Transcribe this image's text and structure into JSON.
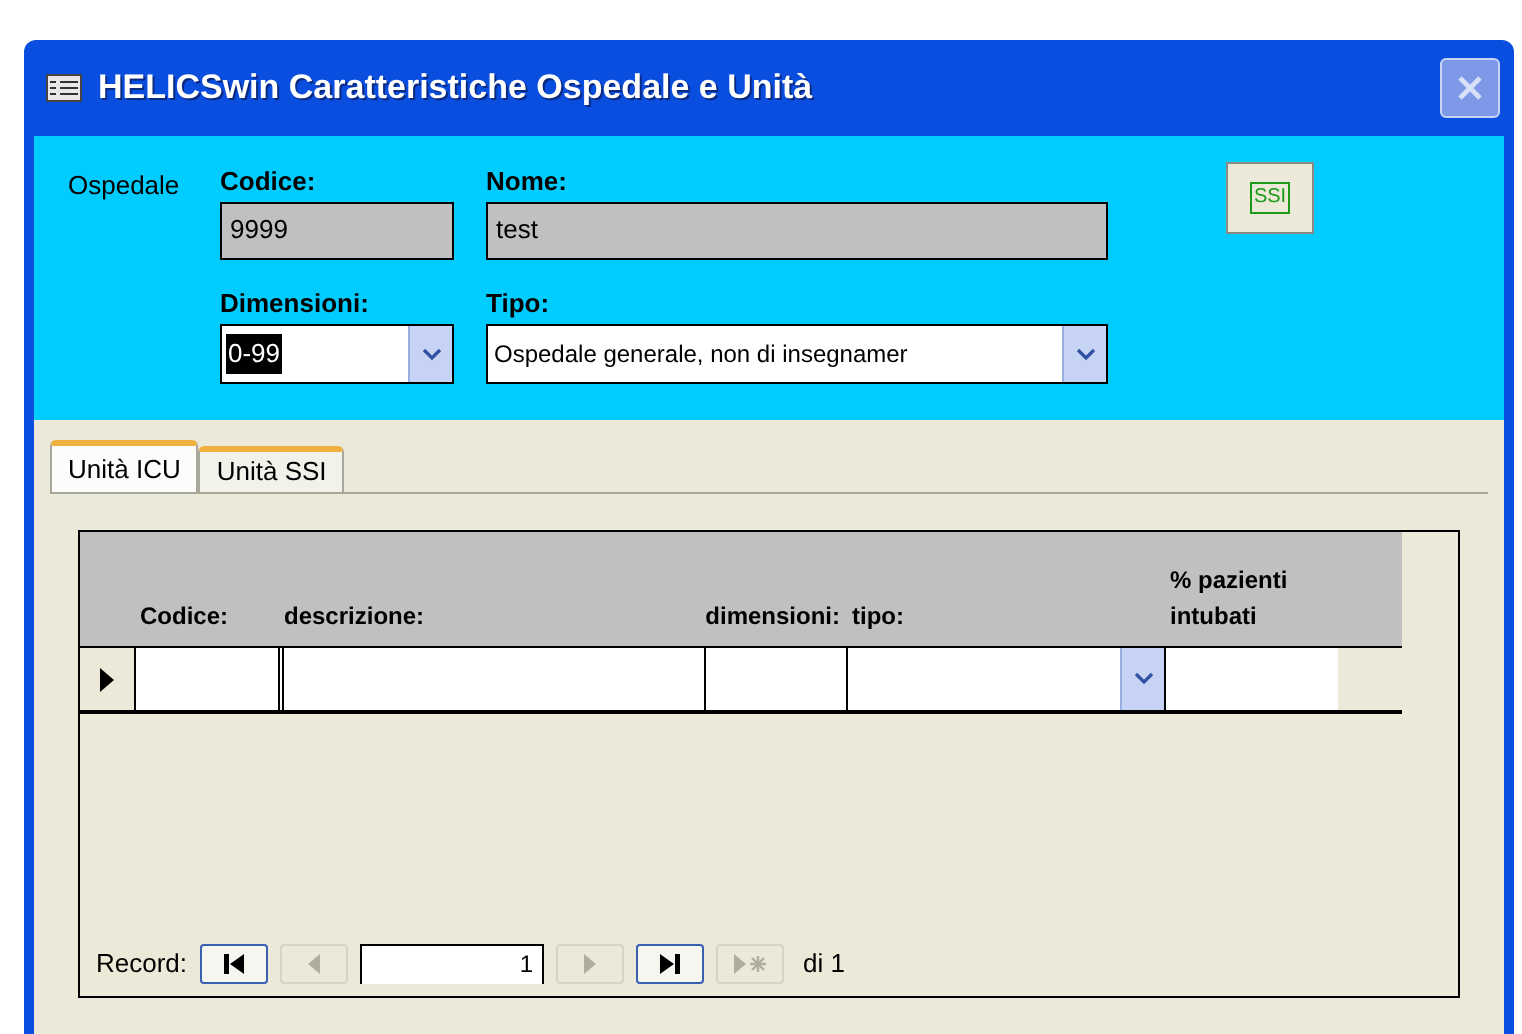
{
  "window": {
    "title": "HELICSwin Caratteristiche Ospedale e Unità"
  },
  "header": {
    "section_label": "Ospedale",
    "codice": {
      "label": "Codice:",
      "value": "9999"
    },
    "nome": {
      "label": "Nome:",
      "value": "test"
    },
    "dimensioni": {
      "label": "Dimensioni:",
      "value": "0-99"
    },
    "tipo": {
      "label": "Tipo:",
      "value": "Ospedale generale, non di insegnamer"
    },
    "ssi_button": "SSI"
  },
  "tabs": [
    {
      "label": "Unità ICU",
      "selected": true
    },
    {
      "label": "Unità SSI",
      "selected": false
    }
  ],
  "table": {
    "columns": [
      {
        "label": "Codice:",
        "kind": "text"
      },
      {
        "label": "descrizione:",
        "kind": "text"
      },
      {
        "label": "dimensioni:",
        "kind": "text"
      },
      {
        "label": "tipo:",
        "kind": "combo"
      },
      {
        "label": "% pazienti intubati",
        "kind": "text"
      }
    ]
  },
  "navigation": {
    "label": "Record:",
    "current": "1",
    "total": "di 1",
    "buttons": [
      {
        "kind": "first",
        "disabled": false
      },
      {
        "kind": "prev",
        "disabled": true
      },
      {
        "kind": "next",
        "disabled": true
      },
      {
        "kind": "last",
        "disabled": false
      },
      {
        "kind": "new",
        "disabled": true
      }
    ]
  }
}
